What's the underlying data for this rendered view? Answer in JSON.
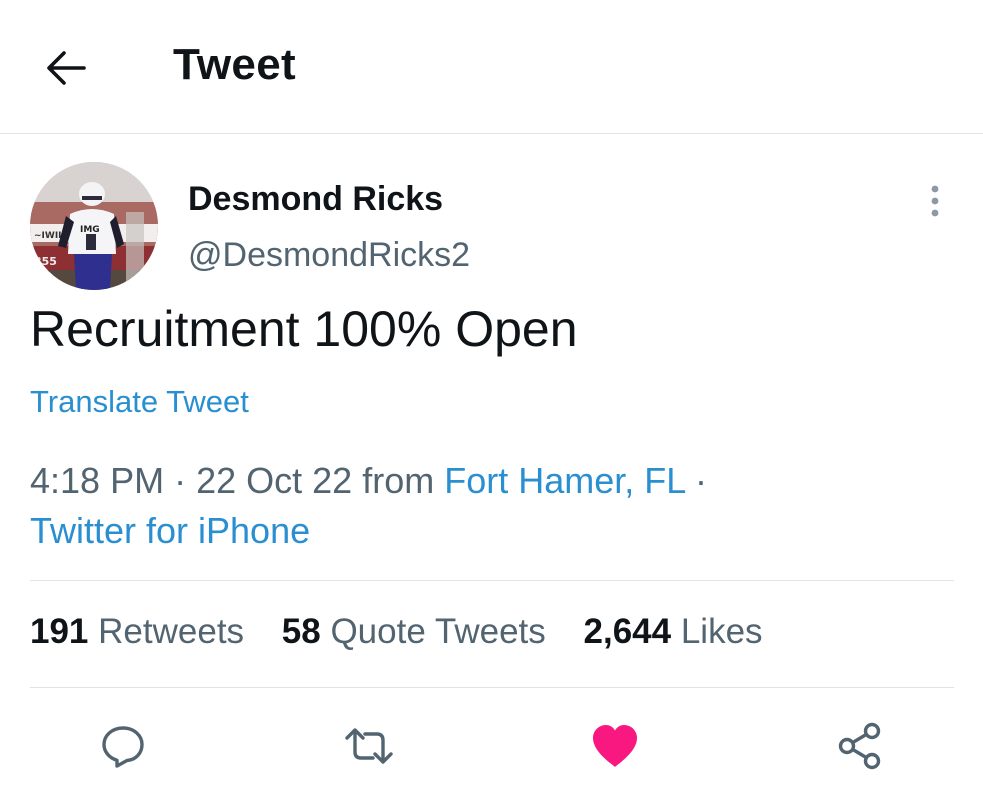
{
  "header": {
    "title": "Tweet",
    "back_icon": "arrow-left-icon"
  },
  "tweet": {
    "author_name": "Desmond Ricks",
    "author_handle": "@DesmondRicks2",
    "avatar_jersey_text": "IMG",
    "text": "Recruitment 100% Open",
    "translate_label": "Translate Tweet",
    "time": "4:18 PM",
    "separator": "·",
    "date": "22 Oct 22",
    "from_label": "from",
    "location": "Fort Hamer, FL",
    "source": "Twitter for iPhone"
  },
  "stats": {
    "retweets_count": "191",
    "retweets_label": "Retweets",
    "quotes_count": "58",
    "quotes_label": "Quote Tweets",
    "likes_count": "2,644",
    "likes_label": "Likes"
  },
  "actions": {
    "icons": [
      "reply-icon",
      "retweet-icon",
      "like-icon",
      "share-icon"
    ],
    "like_color": "#f91880"
  },
  "colors": {
    "link": "#2a8fd0",
    "secondary_text": "#536471",
    "primary_text": "#0f1419",
    "divider": "#e1e4e7"
  }
}
